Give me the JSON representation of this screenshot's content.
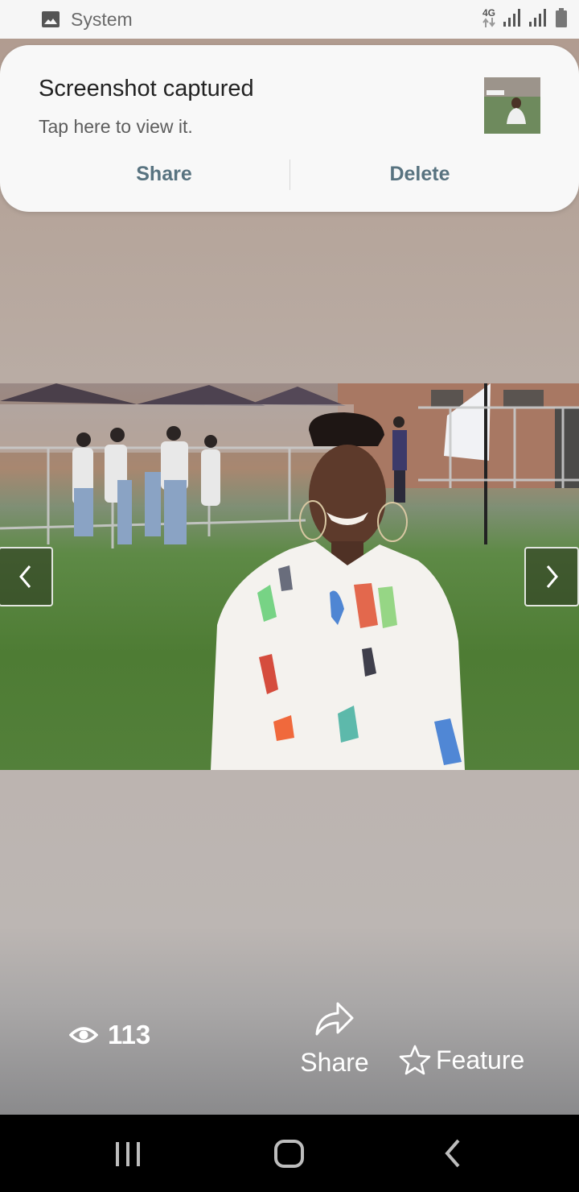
{
  "status_bar": {
    "notification_source": "System",
    "network_type": "4G",
    "icons": [
      "image-icon",
      "data-arrows-icon",
      "signal-icon",
      "signal-icon",
      "battery-icon"
    ]
  },
  "notification": {
    "title": "Screenshot captured",
    "body": "Tap here to view it.",
    "actions": {
      "share": "Share",
      "delete": "Delete"
    }
  },
  "viewer": {
    "photo_icon_prev": "chevron-left-icon",
    "photo_icon_next": "chevron-right-icon",
    "views_count": "113",
    "share_label": "Share",
    "feature_label": "Feature"
  },
  "colors": {
    "action_text": "#587380",
    "status_bar_bg": "#f6f6f6",
    "notification_bg": "#f8f8f8"
  }
}
